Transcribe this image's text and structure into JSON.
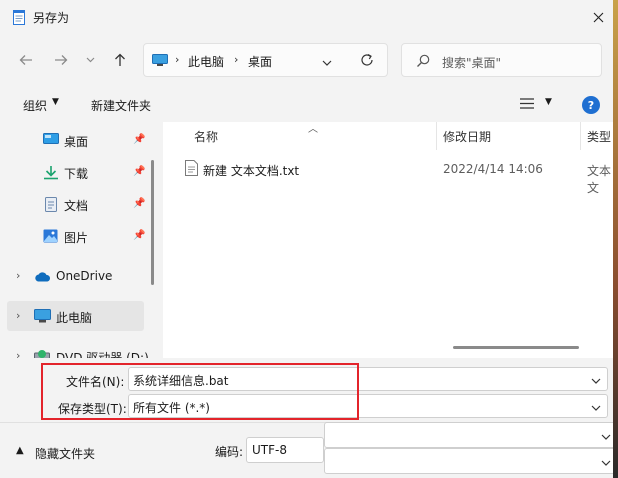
{
  "window": {
    "title": "另存为"
  },
  "address": {
    "segments": [
      "此电脑",
      "桌面"
    ]
  },
  "search": {
    "placeholder": "搜索\"桌面\""
  },
  "toolbar": {
    "organize_label": "组织",
    "new_folder_label": "新建文件夹"
  },
  "sidebar": {
    "items": [
      {
        "label": "桌面",
        "icon": "desktop-icon",
        "pinned": true
      },
      {
        "label": "下载",
        "icon": "download-icon",
        "pinned": true
      },
      {
        "label": "文档",
        "icon": "document-icon",
        "pinned": true
      },
      {
        "label": "图片",
        "icon": "picture-icon",
        "pinned": true
      },
      {
        "label": "OneDrive",
        "icon": "onedrive-icon",
        "expandable": true
      },
      {
        "label": "此电脑",
        "icon": "this-pc-icon",
        "expandable": true,
        "selected": true
      },
      {
        "label": "DVD 驱动器 (D:)",
        "icon": "dvd-drive-icon",
        "expandable": true
      }
    ]
  },
  "filelist": {
    "columns": [
      "名称",
      "修改日期",
      "类型"
    ],
    "rows": [
      {
        "name": "新建 文本文档.txt",
        "modified": "2022/4/14 14:06",
        "type": "文本文"
      }
    ]
  },
  "form": {
    "filename_label": "文件名(N):",
    "filename_value": "系统详细信息.bat",
    "filetype_label": "保存类型(T):",
    "filetype_value": "所有文件  (*.*)"
  },
  "footer": {
    "hide_folders_label": "隐藏文件夹",
    "encoding_label": "编码:",
    "encoding_value": "UTF-8"
  },
  "colors": {
    "highlight": "#e3242b",
    "accent": "#1f6fd1",
    "folder_blue": "#2b78d8"
  }
}
